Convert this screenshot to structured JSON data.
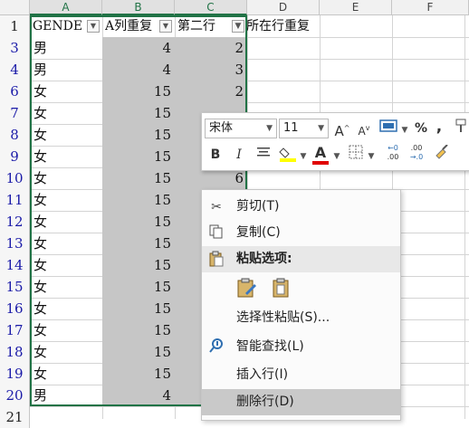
{
  "columns": [
    "A",
    "B",
    "C",
    "D",
    "E",
    "F"
  ],
  "header_row": {
    "row": "1",
    "cells": [
      "GENDER",
      "A列重复",
      "第二行",
      "所在行重复"
    ]
  },
  "rows": [
    {
      "row": "3",
      "gender": "男",
      "b": "4",
      "c": "2"
    },
    {
      "row": "4",
      "gender": "男",
      "b": "4",
      "c": "3"
    },
    {
      "row": "6",
      "gender": "女",
      "b": "15",
      "c": "2"
    },
    {
      "row": "7",
      "gender": "女",
      "b": "15",
      "c": ""
    },
    {
      "row": "8",
      "gender": "女",
      "b": "15",
      "c": ""
    },
    {
      "row": "9",
      "gender": "女",
      "b": "15",
      "c": ""
    },
    {
      "row": "10",
      "gender": "女",
      "b": "15",
      "c": "6"
    },
    {
      "row": "11",
      "gender": "女",
      "b": "15",
      "c": ""
    },
    {
      "row": "12",
      "gender": "女",
      "b": "15",
      "c": ""
    },
    {
      "row": "13",
      "gender": "女",
      "b": "15",
      "c": ""
    },
    {
      "row": "14",
      "gender": "女",
      "b": "15",
      "c": ""
    },
    {
      "row": "15",
      "gender": "女",
      "b": "15",
      "c": ""
    },
    {
      "row": "16",
      "gender": "女",
      "b": "15",
      "c": ""
    },
    {
      "row": "17",
      "gender": "女",
      "b": "15",
      "c": ""
    },
    {
      "row": "18",
      "gender": "女",
      "b": "15",
      "c": ""
    },
    {
      "row": "19",
      "gender": "女",
      "b": "15",
      "c": ""
    },
    {
      "row": "20",
      "gender": "男",
      "b": "4",
      "c": ""
    },
    {
      "row": "21",
      "gender": "",
      "b": "",
      "c": ""
    }
  ],
  "mini_toolbar": {
    "font_name": "宋体",
    "font_size": "11",
    "bold": "B",
    "italic": "I",
    "percent": "%",
    "comma": ",",
    "font_color_glyph": "A",
    "increase_font": "A",
    "decrease_font": "A",
    "increase_decimal_top": "←0",
    "increase_decimal_bottom": ".00",
    "decrease_decimal_top": ".00",
    "decrease_decimal_bottom": "→.0",
    "fill_color": "#ffff00",
    "font_color": "#e00000"
  },
  "context_menu": {
    "items": [
      {
        "label": "剪切(T)",
        "icon": "scissors-icon"
      },
      {
        "label": "复制(C)",
        "icon": "copy-icon"
      },
      {
        "label": "粘贴选项:",
        "icon": "paste-icon"
      },
      {
        "label": "选择性粘贴(S)...",
        "icon": ""
      },
      {
        "label": "智能查找(L)",
        "icon": "smart-lookup-icon"
      },
      {
        "label": "插入行(I)",
        "icon": ""
      },
      {
        "label": "删除行(D)",
        "icon": ""
      }
    ]
  }
}
